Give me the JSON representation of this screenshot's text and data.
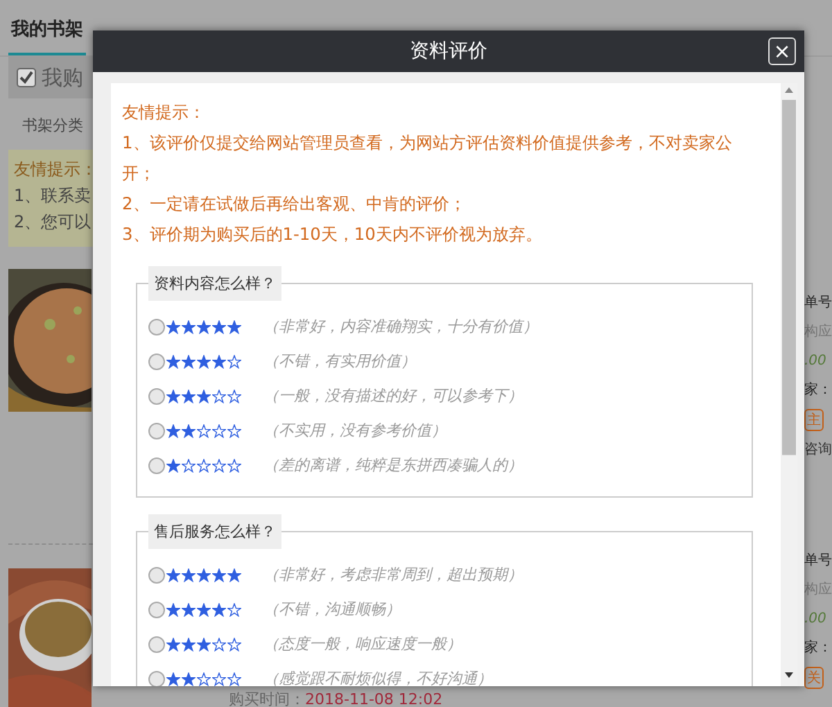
{
  "page": {
    "title": "我的书架",
    "section": "我购",
    "category": "书架分类",
    "tip": {
      "title": "友情提示：",
      "lines": [
        "1、联系卖",
        "2、您可以"
      ]
    },
    "purchase_time": {
      "label": "购买时间：",
      "value": "2018-11-08 12:02"
    },
    "orders": [
      {
        "number": "单号",
        "note": "构应",
        "price": ".00",
        "seller": "家：",
        "follow": "主",
        "consult": "咨询"
      },
      {
        "number": "单号",
        "note": "构应",
        "price": ".00",
        "seller": "家：",
        "follow": "关"
      }
    ]
  },
  "dialog": {
    "title": "资料评价",
    "close": "×",
    "tips": {
      "title": "友情提示：",
      "lines": [
        "1、该评价仅提交给网站管理员查看，为网站方评估资料价值提供参考，不对卖家公开；",
        "2、一定请在试做后再给出客观、中肯的评价；",
        "3、评价期为购买后的1-10天，10天内不评价视为放弃。"
      ]
    },
    "groups": [
      {
        "legend": "资料内容怎么样？",
        "options": [
          {
            "stars": 5,
            "label": "（非常好，内容准确翔实，十分有价值）",
            "selected": false
          },
          {
            "stars": 4,
            "label": "（不错，有实用价值）",
            "selected": false
          },
          {
            "stars": 3,
            "label": "（一般，没有描述的好，可以参考下）",
            "selected": false
          },
          {
            "stars": 2,
            "label": "（不实用，没有参考价值）",
            "selected": false
          },
          {
            "stars": 1,
            "label": "（差的离谱，纯粹是东拼西凑骗人的）",
            "selected": false
          }
        ]
      },
      {
        "legend": "售后服务怎么样？",
        "options": [
          {
            "stars": 5,
            "label": "（非常好，考虑非常周到，超出预期）",
            "selected": false
          },
          {
            "stars": 4,
            "label": "（不错，沟通顺畅）",
            "selected": false
          },
          {
            "stars": 3,
            "label": "（态度一般，响应速度一般）",
            "selected": false
          },
          {
            "stars": 2,
            "label": "（感觉跟不耐烦似得，不好沟通）",
            "selected": false
          }
        ]
      }
    ]
  }
}
